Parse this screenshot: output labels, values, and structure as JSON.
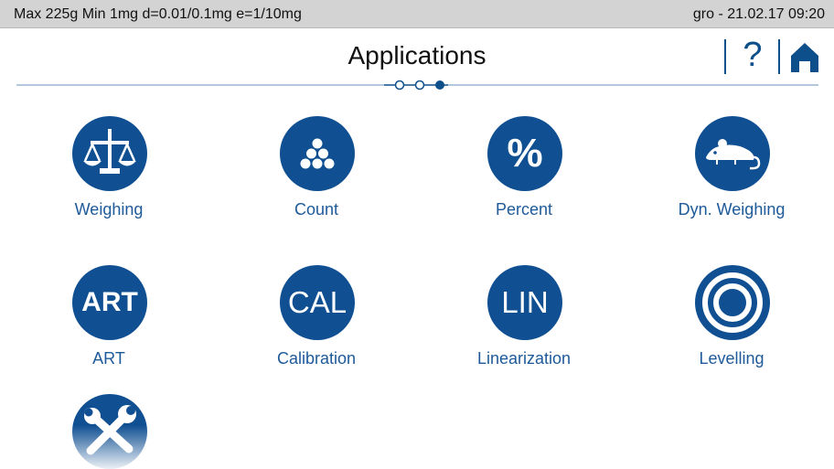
{
  "status": {
    "spec": "Max 225g  Min 1mg  d=0.01/0.1mg  e=1/10mg",
    "user_datetime": "gro  -  21.02.17 09:20"
  },
  "header": {
    "title": "Applications",
    "help_label": "?",
    "pager": {
      "pages": 3,
      "current": 3
    }
  },
  "apps": [
    {
      "label": "Weighing",
      "icon": "balance-scale-icon"
    },
    {
      "label": "Count",
      "icon": "count-dots-icon"
    },
    {
      "label": "Percent",
      "icon": "percent-icon",
      "glyph": "%"
    },
    {
      "label": "Dyn. Weighing",
      "icon": "mouse-icon"
    },
    {
      "label": "ART",
      "icon": "art-icon",
      "glyph": "ART"
    },
    {
      "label": "Calibration",
      "icon": "cal-icon",
      "glyph": "CAL"
    },
    {
      "label": "Linearization",
      "icon": "lin-icon",
      "glyph": "LIN"
    },
    {
      "label": "Levelling",
      "icon": "level-icon"
    },
    {
      "label": "",
      "icon": "tools-icon"
    }
  ],
  "colors": {
    "accent": "#0f4f92",
    "label": "#1e5a99",
    "status_bar": "#d3d3d3"
  }
}
